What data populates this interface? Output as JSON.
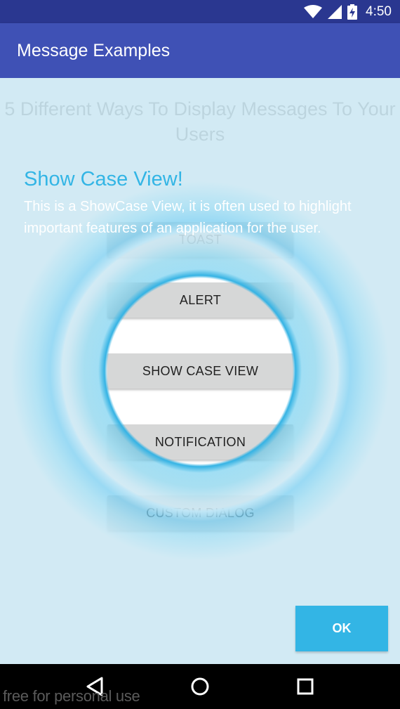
{
  "status_bar": {
    "time": "4:50",
    "icons": [
      "wifi-icon",
      "signal-icon",
      "battery-charging-icon"
    ]
  },
  "app_bar": {
    "title": "Message Examples"
  },
  "main": {
    "heading": "5 Different Ways To Display Messages To Your Users",
    "buttons": [
      {
        "label": "TOAST"
      },
      {
        "label": "ALERT"
      },
      {
        "label": "SHOW CASE VIEW"
      },
      {
        "label": "NOTIFICATION"
      },
      {
        "label": "CUSTOM DIALOG"
      }
    ]
  },
  "showcase": {
    "title": "Show Case View!",
    "text": "This is a ShowCase View, it is often used to highlight important features of an application for the user.",
    "ok_label": "OK",
    "accent_color": "#33b5e5"
  },
  "nav_bar": {
    "icons": [
      "back-icon",
      "home-icon",
      "recents-icon"
    ]
  },
  "watermark": "free for personal use"
}
